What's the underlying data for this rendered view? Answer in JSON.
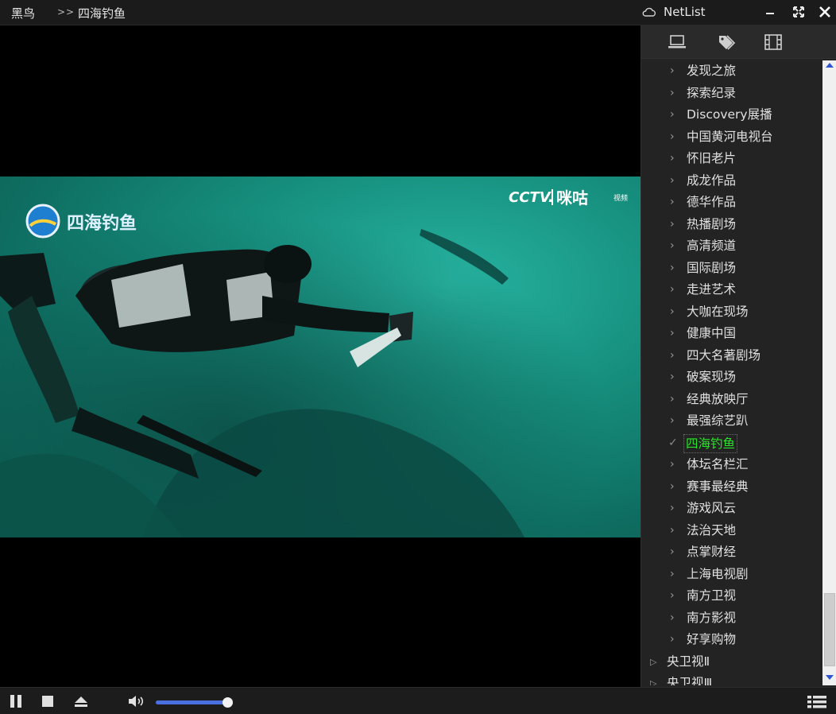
{
  "window": {
    "app_name": "黑鸟",
    "breadcrumb_sep": ">>",
    "now_playing": "四海钓鱼",
    "panel_title": "NetList",
    "minimize": "–",
    "restore": "⤡",
    "close": "✕"
  },
  "video": {
    "channel_logo_text": "四海钓鱼",
    "broadcaster_logo_text": "CCTV.",
    "partner_logo_text": "咪咕",
    "partner_logo_sub": "视频"
  },
  "panel_tabs": [
    "computer-icon",
    "tags-icon",
    "film-icon"
  ],
  "channels": [
    {
      "label": "发现之旅"
    },
    {
      "label": "探索纪录"
    },
    {
      "label": "Discovery展播"
    },
    {
      "label": "中国黄河电视台"
    },
    {
      "label": "怀旧老片"
    },
    {
      "label": "成龙作品"
    },
    {
      "label": "德华作品"
    },
    {
      "label": "热播剧场"
    },
    {
      "label": "高清频道"
    },
    {
      "label": "国际剧场"
    },
    {
      "label": "走进艺术"
    },
    {
      "label": "大咖在现场"
    },
    {
      "label": "健康中国"
    },
    {
      "label": "四大名著剧场"
    },
    {
      "label": "破案现场"
    },
    {
      "label": "经典放映厅"
    },
    {
      "label": "最强综艺趴"
    },
    {
      "label": "四海钓鱼",
      "active": true
    },
    {
      "label": "体坛名栏汇"
    },
    {
      "label": "赛事最经典"
    },
    {
      "label": "游戏风云"
    },
    {
      "label": "法治天地"
    },
    {
      "label": "点掌财经"
    },
    {
      "label": "上海电视剧"
    },
    {
      "label": "南方卫视"
    },
    {
      "label": "南方影视"
    },
    {
      "label": "好享购物"
    }
  ],
  "groups": [
    {
      "label": "央卫视Ⅱ"
    },
    {
      "label": "央卫视Ⅲ"
    }
  ],
  "glyphs": {
    "chevron": "›",
    "check": "✓",
    "triangle": "▷"
  },
  "volume": {
    "level": 0.94
  },
  "colors": {
    "accent": "#4a6fe0",
    "active_channel": "#29e329",
    "water": "#17907f"
  }
}
